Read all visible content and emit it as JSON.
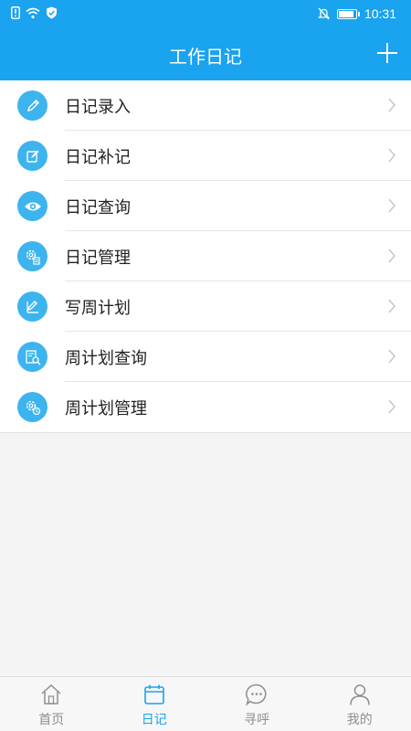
{
  "status_bar": {
    "time": "10:31"
  },
  "header": {
    "title": "工作日记"
  },
  "menu": {
    "items": [
      {
        "label": "日记录入",
        "icon": "pencil-icon"
      },
      {
        "label": "日记补记",
        "icon": "edit-note-icon"
      },
      {
        "label": "日记查询",
        "icon": "eye-icon"
      },
      {
        "label": "日记管理",
        "icon": "gear-doc-icon"
      },
      {
        "label": "写周计划",
        "icon": "pencil-ruler-icon"
      },
      {
        "label": "周计划查询",
        "icon": "doc-search-icon"
      },
      {
        "label": "周计划管理",
        "icon": "gear-clock-icon"
      }
    ]
  },
  "tabbar": {
    "tabs": [
      {
        "label": "首页",
        "icon": "home-icon",
        "active": false
      },
      {
        "label": "日记",
        "icon": "calendar-icon",
        "active": true
      },
      {
        "label": "寻呼",
        "icon": "chat-bubble-icon",
        "active": false
      },
      {
        "label": "我的",
        "icon": "user-icon",
        "active": false
      }
    ]
  },
  "colors": {
    "primary": "#1aa3ee",
    "icon_bg": "#3db4ee",
    "inactive": "#8f8f8f"
  }
}
